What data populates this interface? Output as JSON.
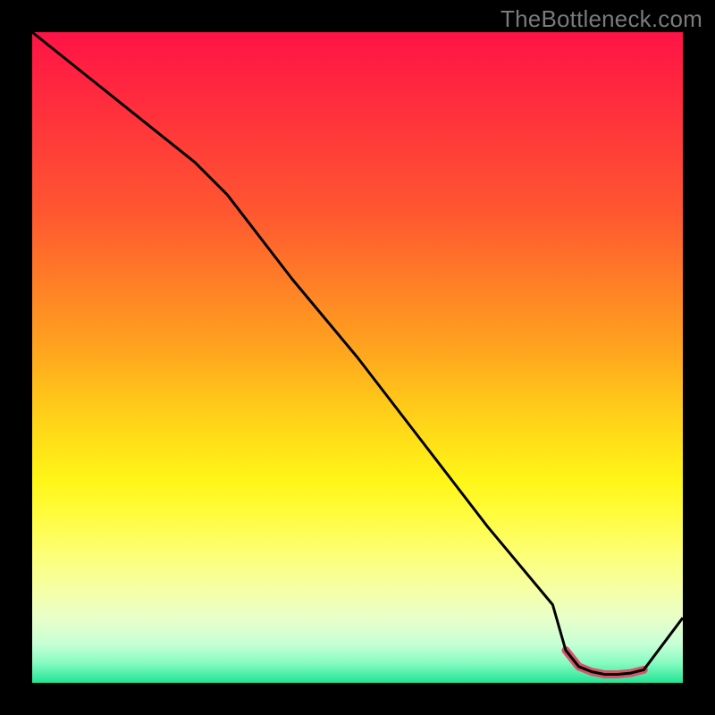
{
  "watermark": "TheBottleneck.com",
  "chart_data": {
    "type": "line",
    "title": "",
    "xlabel": "",
    "ylabel": "",
    "xlim": [
      0,
      100
    ],
    "ylim": [
      0,
      100
    ],
    "x": [
      0,
      10,
      25,
      30,
      40,
      50,
      60,
      70,
      80,
      82,
      84,
      86,
      88,
      90,
      92,
      94,
      100
    ],
    "values": [
      100,
      92,
      80,
      75,
      62,
      50,
      37,
      24,
      12,
      5,
      2.5,
      1.7,
      1.3,
      1.3,
      1.5,
      2.0,
      10
    ],
    "flat_region": {
      "x": [
        82,
        84,
        86,
        88,
        90,
        92,
        94
      ],
      "values": [
        5,
        2.5,
        1.7,
        1.3,
        1.3,
        1.5,
        2.0
      ],
      "stroke_color": "#d9546b",
      "stroke_width": 9
    },
    "line_color": "#000000",
    "line_width": 3
  }
}
